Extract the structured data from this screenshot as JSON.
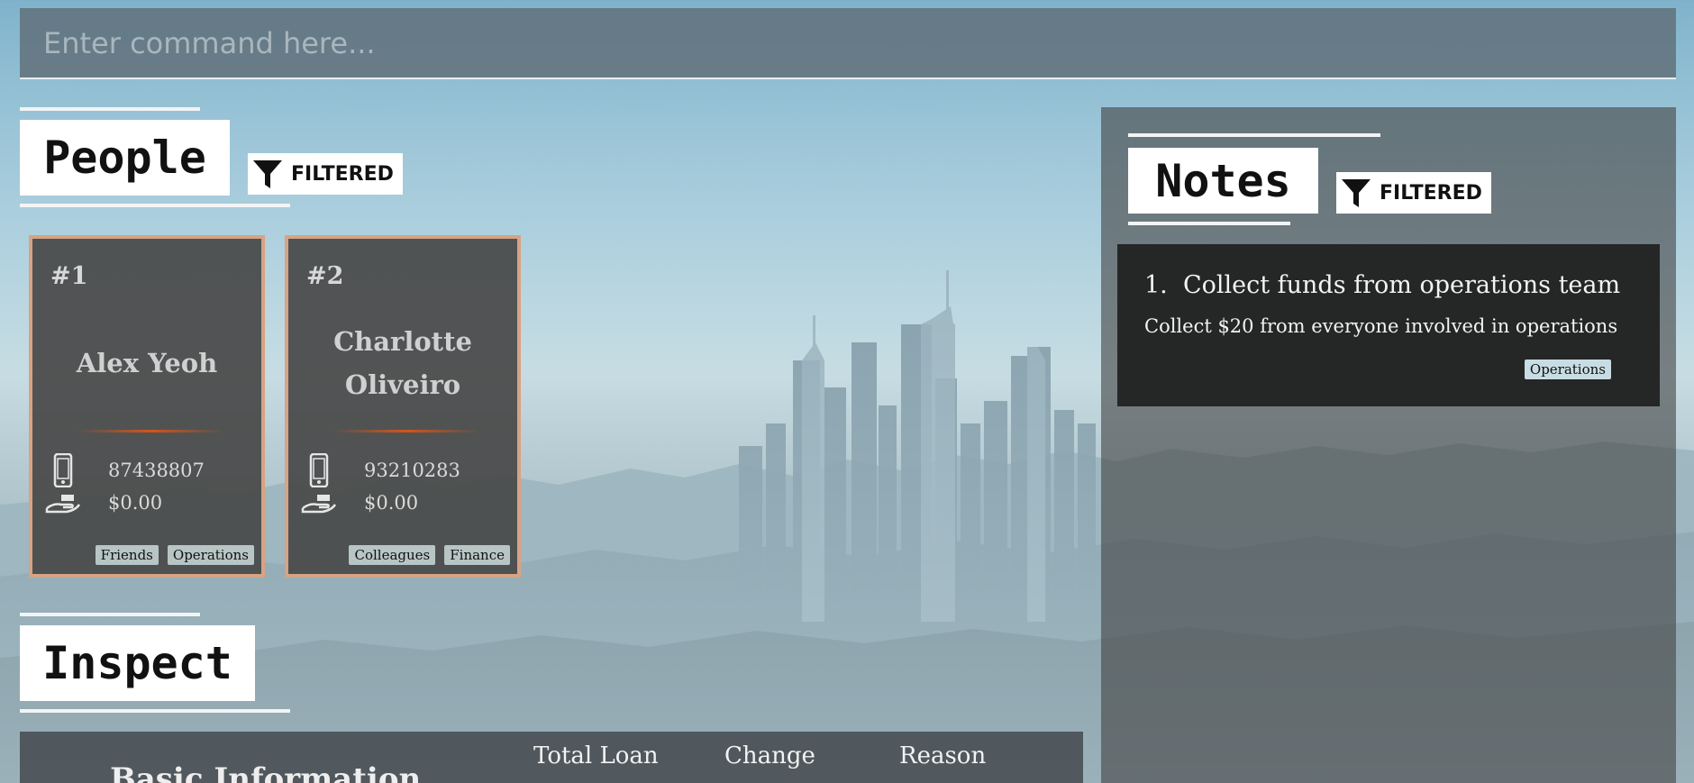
{
  "command_bar": {
    "placeholder": "Enter command here..."
  },
  "people": {
    "title": "People",
    "filter_label": "FILTERED",
    "persons": [
      {
        "index": "#1",
        "name_lines": [
          "Alex Yeoh"
        ],
        "phone": "87438807",
        "loan": "$0.00",
        "tags": [
          "Friends",
          "Operations"
        ]
      },
      {
        "index": "#2",
        "name_lines": [
          "Charlotte",
          "Oliveiro"
        ],
        "phone": "93210283",
        "loan": "$0.00",
        "tags": [
          "Colleagues",
          "Finance"
        ]
      }
    ]
  },
  "notes": {
    "title": "Notes",
    "filter_label": "FILTERED",
    "items": [
      {
        "number": "1.",
        "title": "Collect funds from operations team",
        "body": "Collect $20 from everyone involved in operations",
        "tag": "Operations"
      }
    ]
  },
  "inspect": {
    "title": "Inspect",
    "columns": [
      "Total Loan",
      "Change",
      "Reason"
    ],
    "section_title": "Basic Information"
  },
  "colors": {
    "card_border": "#d6a384",
    "card_accent": "#d4541a",
    "tag_bg": "#b7c6c4",
    "note_tag_bg": "#c8dde3"
  },
  "icons": [
    "phone-icon",
    "loan-hand-icon",
    "filter-funnel-icon"
  ]
}
